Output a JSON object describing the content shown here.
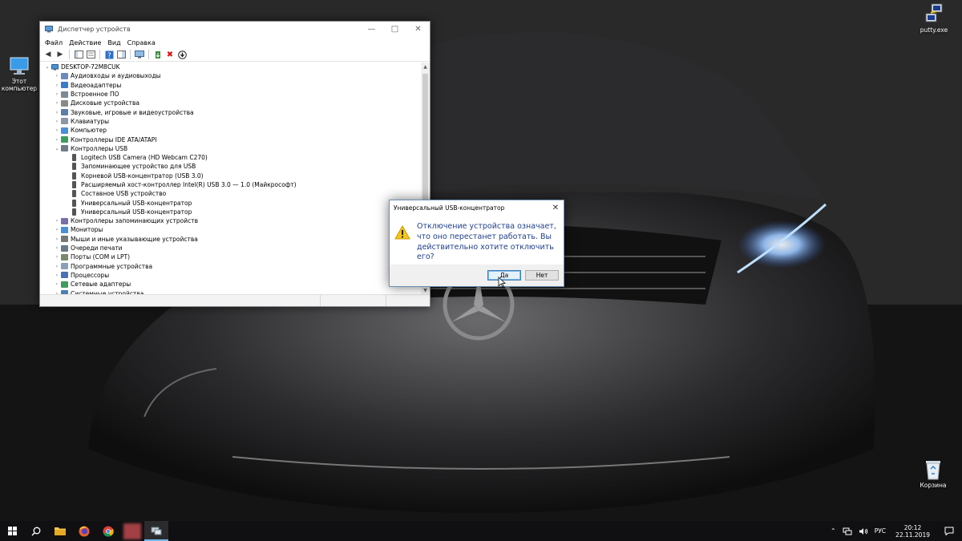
{
  "desktop": {
    "icons": [
      {
        "label_line1": "Этот",
        "label_line2": "компьютер"
      },
      {
        "label_line1": "putty.exe",
        "label_line2": ""
      },
      {
        "label_line1": "Корзина",
        "label_line2": ""
      }
    ]
  },
  "device_manager": {
    "title": "Диспетчер устройств",
    "menu": [
      "Файл",
      "Действие",
      "Вид",
      "Справка"
    ],
    "computer": "DESKTOP-72M8CUK",
    "tree": [
      {
        "label": "Аудиовходы и аудиовыходы",
        "level": 1,
        "expander": "›"
      },
      {
        "label": "Видеоадаптеры",
        "level": 1,
        "expander": "›"
      },
      {
        "label": "Встроенное ПО",
        "level": 1,
        "expander": "›"
      },
      {
        "label": "Дисковые устройства",
        "level": 1,
        "expander": "›"
      },
      {
        "label": "Звуковые, игровые и видеоустройства",
        "level": 1,
        "expander": "›"
      },
      {
        "label": "Клавиатуры",
        "level": 1,
        "expander": "›"
      },
      {
        "label": "Компьютер",
        "level": 1,
        "expander": "›"
      },
      {
        "label": "Контроллеры IDE ATA/ATAPI",
        "level": 1,
        "expander": "›"
      },
      {
        "label": "Контроллеры USB",
        "level": 1,
        "expander": "⌄"
      },
      {
        "label": "Logitech USB Camera (HD Webcam C270)",
        "level": 2,
        "expander": ""
      },
      {
        "label": "Запоминающее устройство для USB",
        "level": 2,
        "expander": ""
      },
      {
        "label": "Корневой USB-концентратор (USB 3.0)",
        "level": 2,
        "expander": ""
      },
      {
        "label": "Расширяемый хост-контроллер Intel(R) USB 3.0 — 1.0 (Майкрософт)",
        "level": 2,
        "expander": ""
      },
      {
        "label": "Составное USB устройство",
        "level": 2,
        "expander": ""
      },
      {
        "label": "Универсальный USB-концентратор",
        "level": 2,
        "expander": ""
      },
      {
        "label": "Универсальный USB-концентратор",
        "level": 2,
        "expander": ""
      },
      {
        "label": "Контроллеры запоминающих устройств",
        "level": 1,
        "expander": "›"
      },
      {
        "label": "Мониторы",
        "level": 1,
        "expander": "›"
      },
      {
        "label": "Мыши и иные указывающие устройства",
        "level": 1,
        "expander": "›"
      },
      {
        "label": "Очереди печати",
        "level": 1,
        "expander": "›"
      },
      {
        "label": "Порты (COM и LPT)",
        "level": 1,
        "expander": "›"
      },
      {
        "label": "Программные устройства",
        "level": 1,
        "expander": "›"
      },
      {
        "label": "Процессоры",
        "level": 1,
        "expander": "›"
      },
      {
        "label": "Сетевые адаптеры",
        "level": 1,
        "expander": "›"
      },
      {
        "label": "Системные устройства",
        "level": 1,
        "expander": "›"
      }
    ]
  },
  "dialog": {
    "title": "Универсальный USB-концентратор",
    "message": "Отключение устройства означает, что оно перестанет работать. Вы действительно хотите отключить его?",
    "yes": "Да",
    "no": "Нет"
  },
  "taskbar": {
    "language": "РУС",
    "time": "20:12",
    "date": "22.11.2019"
  }
}
